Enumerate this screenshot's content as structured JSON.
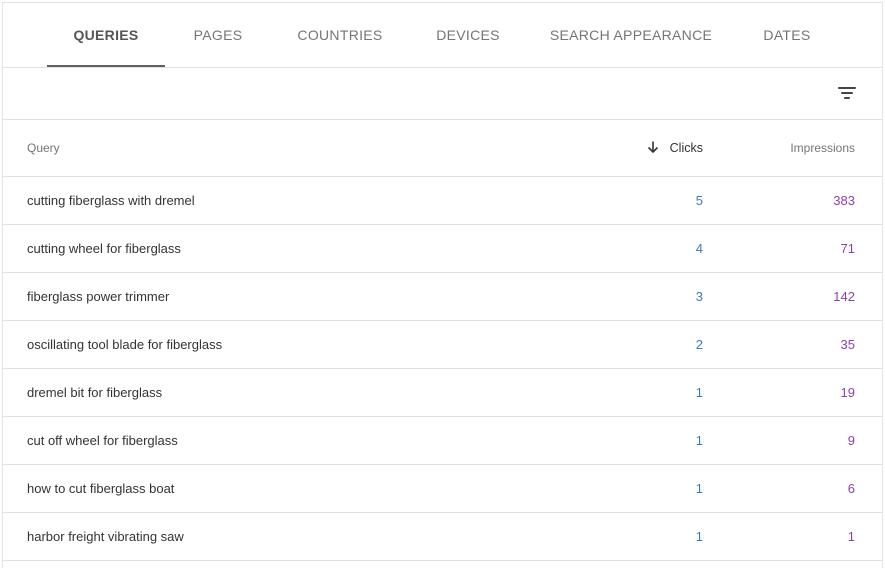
{
  "tabs": [
    {
      "label": "QUERIES",
      "active": true
    },
    {
      "label": "PAGES",
      "active": false
    },
    {
      "label": "COUNTRIES",
      "active": false
    },
    {
      "label": "DEVICES",
      "active": false
    },
    {
      "label": "SEARCH APPEARANCE",
      "active": false
    },
    {
      "label": "DATES",
      "active": false
    }
  ],
  "toolbar": {
    "filter_icon": "filter-list-icon"
  },
  "table": {
    "headers": {
      "query": "Query",
      "clicks": "Clicks",
      "impressions": "Impressions"
    },
    "sort_icon": "arrow-down-icon",
    "rows": [
      {
        "query": "cutting fiberglass with dremel",
        "clicks": "5",
        "impressions": "383"
      },
      {
        "query": "cutting wheel for fiberglass",
        "clicks": "4",
        "impressions": "71"
      },
      {
        "query": "fiberglass power trimmer",
        "clicks": "3",
        "impressions": "142"
      },
      {
        "query": "oscillating tool blade for fiberglass",
        "clicks": "2",
        "impressions": "35"
      },
      {
        "query": "dremel bit for fiberglass",
        "clicks": "1",
        "impressions": "19"
      },
      {
        "query": "cut off wheel for fiberglass",
        "clicks": "1",
        "impressions": "9"
      },
      {
        "query": "how to cut fiberglass boat",
        "clicks": "1",
        "impressions": "6"
      },
      {
        "query": "harbor freight vibrating saw",
        "clicks": "1",
        "impressions": "1"
      }
    ]
  },
  "colors": {
    "clicks": "#3b7bbf",
    "impressions": "#8e3fb0",
    "active_tab_indicator": "#616161"
  }
}
